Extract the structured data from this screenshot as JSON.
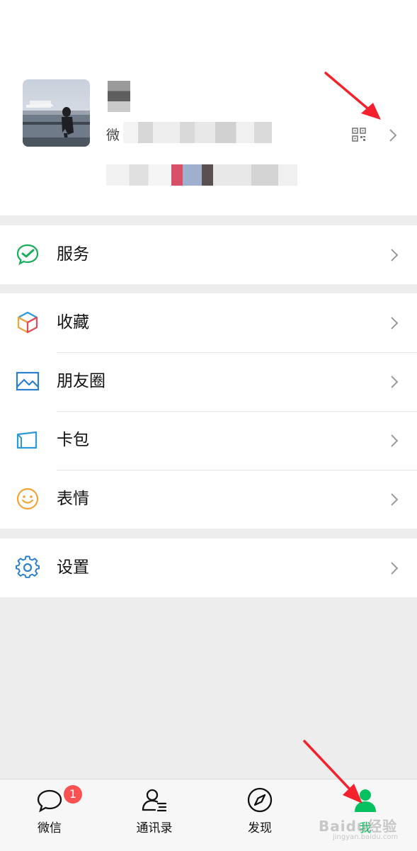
{
  "profile": {
    "wechat_id_prefix": "微"
  },
  "menu": {
    "services": {
      "label": "服务",
      "icon": "services-icon"
    },
    "favorites": {
      "label": "收藏",
      "icon": "favorites-cube-icon"
    },
    "moments": {
      "label": "朋友圈",
      "icon": "moments-picture-icon"
    },
    "cards": {
      "label": "卡包",
      "icon": "card-wallet-icon"
    },
    "stickers": {
      "label": "表情",
      "icon": "smiley-icon"
    },
    "settings": {
      "label": "设置",
      "icon": "gear-icon"
    }
  },
  "tabbar": {
    "chats": {
      "label": "微信",
      "badge": "1"
    },
    "contacts": {
      "label": "通讯录"
    },
    "discover": {
      "label": "发现"
    },
    "me": {
      "label": "我"
    }
  },
  "watermark": {
    "text": "Baidu经验",
    "sub": "jingyan.baidu.com"
  },
  "colors": {
    "accent": "#07c160",
    "arrow": "#f5222d",
    "badge": "#fa5151",
    "background": "#ededed"
  }
}
